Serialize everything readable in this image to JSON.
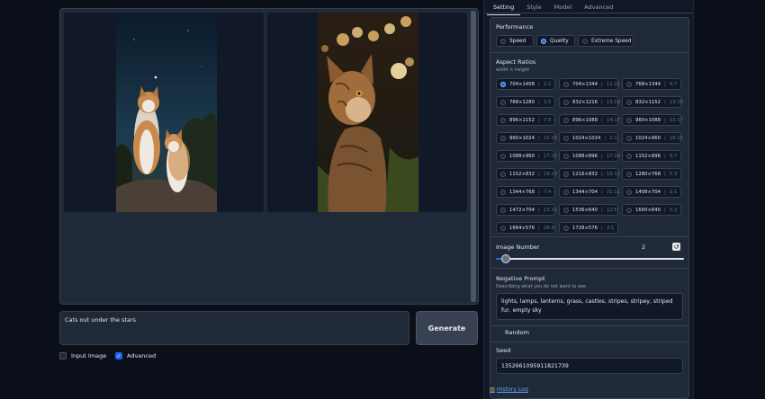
{
  "gallery": {
    "images": [
      {
        "name": "two-cats-under-stars"
      },
      {
        "name": "tabby-cat-bokeh-lights"
      }
    ]
  },
  "prompt": {
    "value": "Cats out under the stars"
  },
  "generate_label": "Generate",
  "options": {
    "input_image": {
      "label": "Input Image",
      "checked": false
    },
    "advanced": {
      "label": "Advanced",
      "checked": true
    }
  },
  "tabs": [
    "Setting",
    "Style",
    "Model",
    "Advanced"
  ],
  "performance": {
    "title": "Performance",
    "options": [
      "Speed",
      "Quality",
      "Extreme Speed"
    ],
    "selected": "Quality"
  },
  "aspect": {
    "title": "Aspect Ratios",
    "subtitle": "width × height",
    "items": [
      {
        "size": "704×1408",
        "ratio": "1:2"
      },
      {
        "size": "704×1344",
        "ratio": "11:21"
      },
      {
        "size": "768×1344",
        "ratio": "4:7"
      },
      {
        "size": "768×1280",
        "ratio": "3:5"
      },
      {
        "size": "832×1216",
        "ratio": "13:19"
      },
      {
        "size": "832×1152",
        "ratio": "13:18"
      },
      {
        "size": "896×1152",
        "ratio": "7:9"
      },
      {
        "size": "896×1088",
        "ratio": "14:17"
      },
      {
        "size": "960×1088",
        "ratio": "15:17"
      },
      {
        "size": "960×1024",
        "ratio": "15:16"
      },
      {
        "size": "1024×1024",
        "ratio": "1:1"
      },
      {
        "size": "1024×960",
        "ratio": "16:15"
      },
      {
        "size": "1088×960",
        "ratio": "17:15"
      },
      {
        "size": "1088×896",
        "ratio": "17:14"
      },
      {
        "size": "1152×896",
        "ratio": "9:7"
      },
      {
        "size": "1152×832",
        "ratio": "18:13"
      },
      {
        "size": "1216×832",
        "ratio": "19:13"
      },
      {
        "size": "1280×768",
        "ratio": "5:3"
      },
      {
        "size": "1344×768",
        "ratio": "7:4"
      },
      {
        "size": "1344×704",
        "ratio": "21:11"
      },
      {
        "size": "1408×704",
        "ratio": "2:1"
      },
      {
        "size": "1472×704",
        "ratio": "23:11"
      },
      {
        "size": "1536×640",
        "ratio": "12:5"
      },
      {
        "size": "1600×640",
        "ratio": "5:2"
      },
      {
        "size": "1664×576",
        "ratio": "26:9"
      },
      {
        "size": "1728×576",
        "ratio": "3:1"
      }
    ],
    "selected_index": 0
  },
  "image_number": {
    "title": "Image Number",
    "value": "2",
    "reset_icon": "reset-icon"
  },
  "negative_prompt": {
    "title": "Negative Prompt",
    "subtitle": "Describing what you do not want to see.",
    "value": "lights, lamps, lanterns, grass, castles, stripes, stripey, striped fur, empty sky"
  },
  "random": {
    "label": "Random",
    "checked": false
  },
  "seed": {
    "title": "Seed",
    "value": "1352661095911821739"
  },
  "history_log": "History Log",
  "colors": {
    "accent": "#2563eb",
    "panel": "#1f2937",
    "background": "#0b0f19"
  }
}
